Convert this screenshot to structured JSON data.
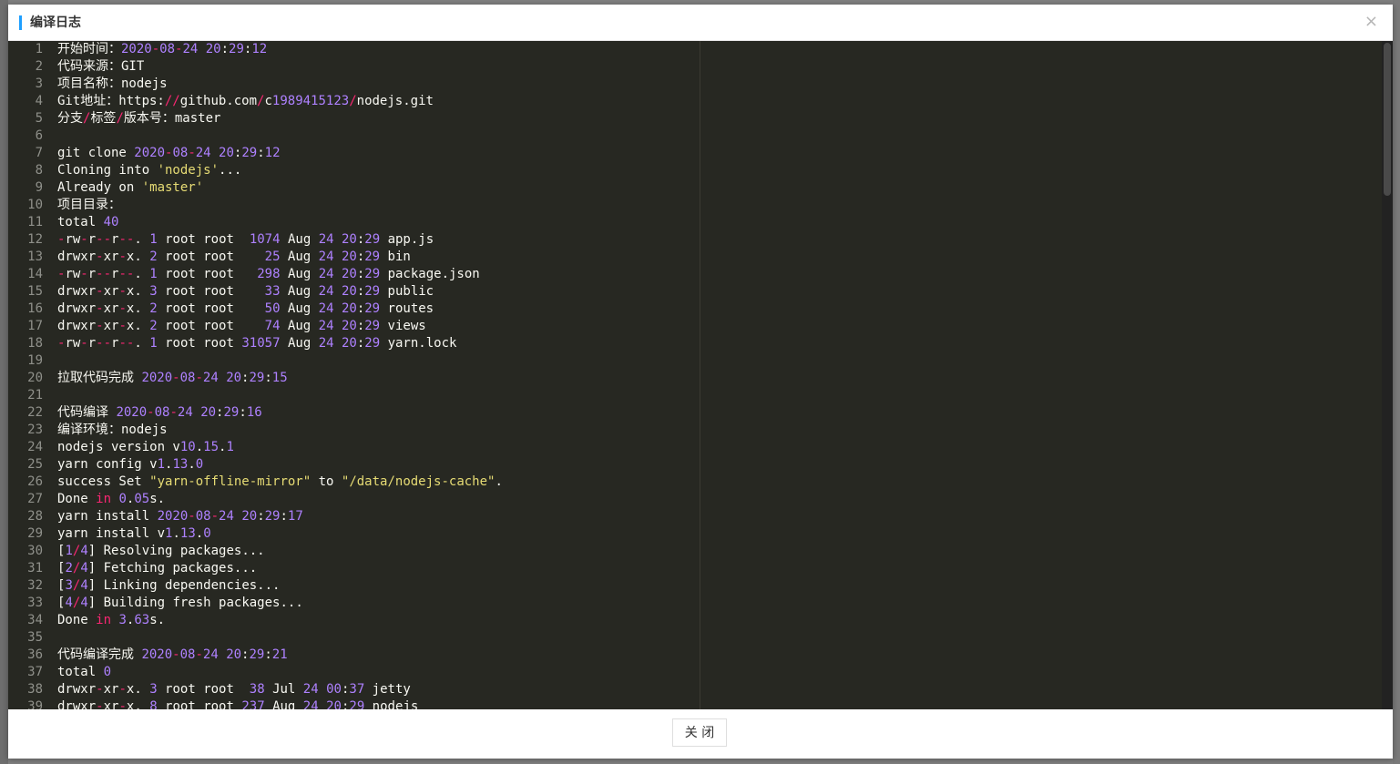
{
  "dialog": {
    "title": "编译日志",
    "close_icon_char": "×",
    "close_button_label": "关 闭"
  },
  "theme": {
    "editor_bg": "#272822",
    "text": "#f8f8f2",
    "number": "#ae81ff",
    "string": "#e6db74",
    "operator": "#f92672",
    "accent": "#1e9fff"
  },
  "log_lines": [
    "开始时间：2020-08-24 20:29:12",
    "代码来源：GIT",
    "项目名称：nodejs",
    "Git地址：https://github.com/c1989415123/nodejs.git",
    "分支/标签/版本号：master",
    "",
    "git clone 2020-08-24 20:29:12",
    "Cloning into 'nodejs'...",
    "Already on 'master'",
    "项目目录：",
    "total 40",
    "-rw-r--r--. 1 root root  1074 Aug 24 20:29 app.js",
    "drwxr-xr-x. 2 root root    25 Aug 24 20:29 bin",
    "-rw-r--r--. 1 root root   298 Aug 24 20:29 package.json",
    "drwxr-xr-x. 3 root root    33 Aug 24 20:29 public",
    "drwxr-xr-x. 2 root root    50 Aug 24 20:29 routes",
    "drwxr-xr-x. 2 root root    74 Aug 24 20:29 views",
    "-rw-r--r--. 1 root root 31057 Aug 24 20:29 yarn.lock",
    "",
    "拉取代码完成 2020-08-24 20:29:15",
    "",
    "代码编译 2020-08-24 20:29:16",
    "编译环境：nodejs",
    "nodejs version v10.15.1",
    "yarn config v1.13.0",
    "success Set \"yarn-offline-mirror\" to \"/data/nodejs-cache\".",
    "Done in 0.05s.",
    "yarn install 2020-08-24 20:29:17",
    "yarn install v1.13.0",
    "[1/4] Resolving packages...",
    "[2/4] Fetching packages...",
    "[3/4] Linking dependencies...",
    "[4/4] Building fresh packages...",
    "Done in 3.63s.",
    "",
    "代码编译完成 2020-08-24 20:29:21",
    "total 0",
    "drwxr-xr-x. 3 root root  38 Jul 24 00:37 jetty",
    "drwxr-xr-x. 8 root root 237 Aug 24 20:29 nodejs"
  ]
}
